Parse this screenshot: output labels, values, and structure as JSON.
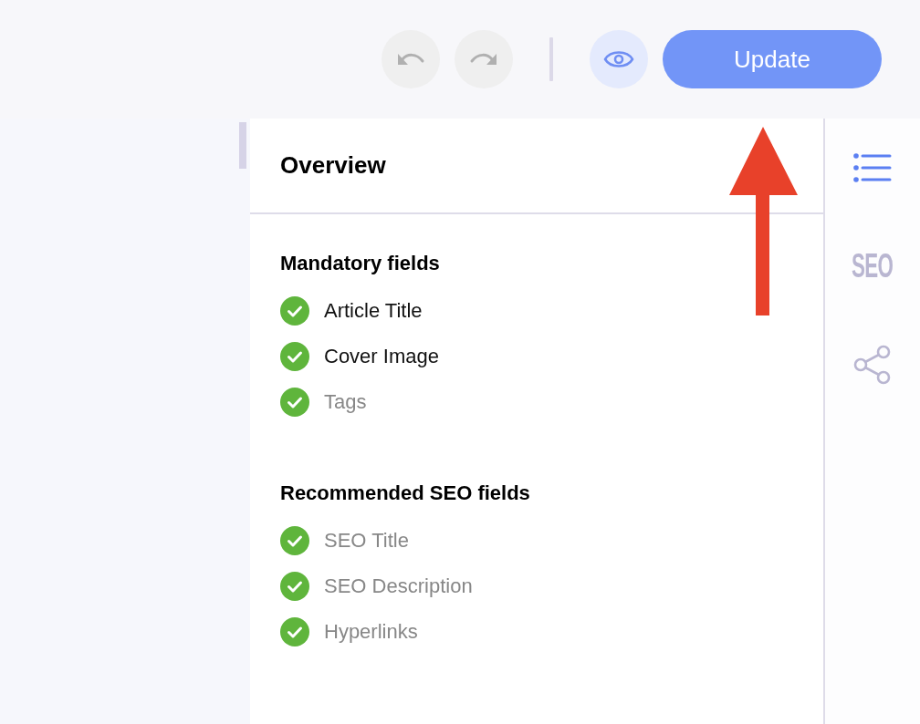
{
  "toolbar": {
    "history_buttons": [
      {
        "kind": "undo",
        "disabled": true
      },
      {
        "kind": "redo",
        "disabled": true
      }
    ],
    "update_button": {
      "label": "Update"
    }
  },
  "panel": {
    "title": "Overview",
    "sections": [
      {
        "heading": "Mandatory fields",
        "items": [
          {
            "label": "Article Title",
            "checked": true,
            "muted": false
          },
          {
            "label": "Cover Image",
            "checked": true,
            "muted": false
          },
          {
            "label": "Tags",
            "checked": true,
            "muted": true
          }
        ]
      },
      {
        "heading": "Recommended SEO fields",
        "items": [
          {
            "label": "SEO Title",
            "checked": true,
            "muted": true
          },
          {
            "label": "SEO Description",
            "checked": true,
            "muted": true
          },
          {
            "label": "Hyperlinks",
            "checked": true,
            "muted": true
          }
        ]
      }
    ]
  },
  "rail": {
    "tabs": [
      {
        "kind": "list",
        "selected": true
      },
      {
        "kind": "seo",
        "label": "SEO",
        "selected": false
      },
      {
        "kind": "share",
        "selected": false
      }
    ]
  }
}
